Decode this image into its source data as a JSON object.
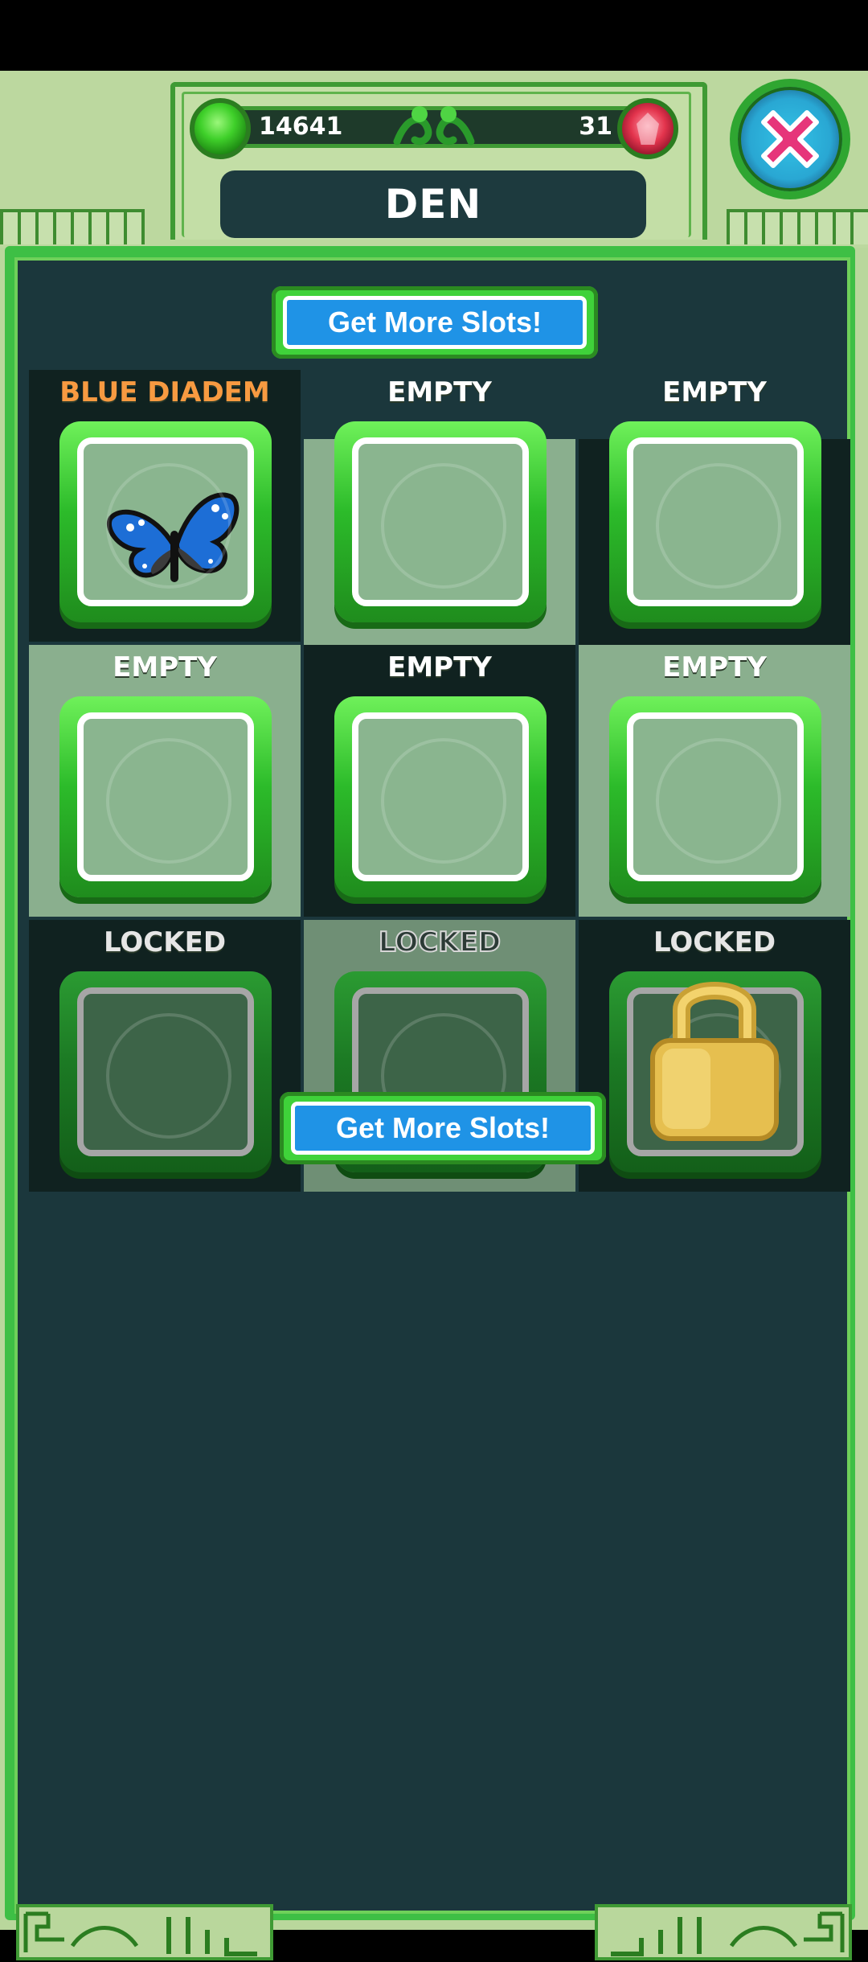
{
  "header": {
    "soft_currency": "14641",
    "premium_currency": "31",
    "title": "DEN",
    "icons": {
      "soft": "green-gem-icon",
      "premium": "red-crystal-icon",
      "close": "close-x-icon",
      "divider": "vine-ornament-icon"
    }
  },
  "buttons": {
    "get_more_slots": "Get More Slots!"
  },
  "slots": [
    {
      "label": "BLUE DIADEM",
      "state": "occupied",
      "item": "butterfly-icon"
    },
    {
      "label": "EMPTY",
      "state": "empty"
    },
    {
      "label": "EMPTY",
      "state": "empty"
    },
    {
      "label": "EMPTY",
      "state": "empty"
    },
    {
      "label": "EMPTY",
      "state": "empty"
    },
    {
      "label": "EMPTY",
      "state": "empty"
    },
    {
      "label": "LOCKED",
      "state": "locked"
    },
    {
      "label": "LOCKED",
      "state": "locked"
    },
    {
      "label": "LOCKED",
      "state": "locked",
      "item": "padlock-icon"
    }
  ],
  "colors": {
    "accent_green": "#3fd23a",
    "button_blue": "#1f93e6",
    "highlight_label": "#f79a41",
    "panel_bg": "#1b373c"
  }
}
